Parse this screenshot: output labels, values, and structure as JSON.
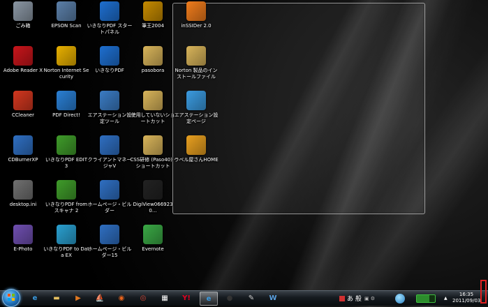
{
  "desktop_icons": [
    {
      "label": "ごみ箱",
      "icon": "recycle-bin-icon",
      "color": "#8a96a3"
    },
    {
      "label": "EPSON Scan",
      "icon": "scanner-icon",
      "color": "#5b7fa8"
    },
    {
      "label": "いきなりPDF スタートパネル",
      "icon": "pdf-start-panel-icon",
      "color": "#1e6fd0"
    },
    {
      "label": "筆王2004",
      "icon": "fudeou-icon",
      "color": "#c58a00"
    },
    {
      "label": "inSSIDer 2.0",
      "icon": "inssider-icon",
      "color": "#f07c1c"
    },
    {
      "label": "Adobe Reader X",
      "icon": "adobe-reader-icon",
      "color": "#c8151b"
    },
    {
      "label": "Norton Internet Security",
      "icon": "norton-icon",
      "color": "#e8b000"
    },
    {
      "label": "いきなりPDF",
      "icon": "ikinari-pdf-icon",
      "color": "#1e6fd0"
    },
    {
      "label": "pasobora",
      "icon": "folder-icon",
      "color": "#d8b45a"
    },
    {
      "label": "Norton 製品のインストールファイル",
      "icon": "folder-icon",
      "color": "#d8b45a"
    },
    {
      "label": "CCleaner",
      "icon": "ccleaner-icon",
      "color": "#d2371f"
    },
    {
      "label": "PDF Direct!",
      "icon": "pdf-direct-icon",
      "color": "#2a7fd4"
    },
    {
      "label": "エアステーション設定ツール",
      "icon": "airstation-tool-icon",
      "color": "#3b7cc4"
    },
    {
      "label": "使用していないショートカット",
      "icon": "folder-icon",
      "color": "#d8b45a"
    },
    {
      "label": "エアステーション設定ページ",
      "icon": "ie-page-icon",
      "color": "#3b9be0"
    },
    {
      "label": "CDBurnerXP",
      "icon": "cdburner-icon",
      "color": "#2f6fc2"
    },
    {
      "label": "いきなりPDF EDIT 3",
      "icon": "pdf-edit-icon",
      "color": "#3f9b2a"
    },
    {
      "label": "クライアントマネージャV",
      "icon": "client-manager-icon",
      "color": "#2f6fc2"
    },
    {
      "label": "CSS研修 (Paso40) - ショートカット",
      "icon": "shortcut-folder-icon",
      "color": "#d8b45a"
    },
    {
      "label": "ラベル屋さんHOME",
      "icon": "label-ya-icon",
      "color": "#e8a020"
    },
    {
      "label": "desktop.ini",
      "icon": "file-icon",
      "color": "#707070"
    },
    {
      "label": "いきなりPDF from スキャナ 2",
      "icon": "pdf-scanner-icon",
      "color": "#3f9b2a"
    },
    {
      "label": "ホームページ・ビルダー",
      "icon": "homepage-builder-icon",
      "color": "#2f6fc2"
    },
    {
      "label": "DigiView0669230...",
      "icon": "digiview-icon",
      "color": "#222222"
    },
    {
      "label": "E-Photo",
      "icon": "ephoto-icon",
      "color": "#6f4fb0"
    },
    {
      "label": "いきなりPDF to Data EX",
      "icon": "pdf-data-ex-icon",
      "color": "#2aa0d0"
    },
    {
      "label": "ホームページ・ビルダー15",
      "icon": "homepage-builder-icon",
      "color": "#2f6fc2"
    },
    {
      "label": "Evernote",
      "icon": "evernote-icon",
      "color": "#3aa845"
    }
  ],
  "taskbar": {
    "pinned": [
      {
        "name": "internet-explorer-icon",
        "glyph": "e",
        "color": "#3b9be0"
      },
      {
        "name": "explorer-folder-icon",
        "glyph": "▬",
        "color": "#e6c060"
      },
      {
        "name": "media-player-icon",
        "glyph": "▶",
        "color": "#e07820"
      },
      {
        "name": "ship-app-icon",
        "glyph": "⛵",
        "color": "#9aa"
      },
      {
        "name": "firefox-icon",
        "glyph": "◉",
        "color": "#e8641c"
      },
      {
        "name": "chrome-icon",
        "glyph": "◎",
        "color": "#dd4b39"
      },
      {
        "name": "app-grid-icon",
        "glyph": "▦",
        "color": "#ffffff"
      },
      {
        "name": "yahoo-icon",
        "glyph": "Y!",
        "color": "#e00020"
      },
      {
        "name": "ie-page-icon",
        "glyph": "e",
        "color": "#3b9be0"
      },
      {
        "name": "dark-disc-icon",
        "glyph": "●",
        "color": "#333333"
      },
      {
        "name": "paint-icon",
        "glyph": "✎",
        "color": "#ccc"
      },
      {
        "name": "homepage-builder-icon",
        "glyph": "W",
        "color": "#5aa0e0"
      }
    ],
    "ime": "あ 般",
    "battery_icon": "battery-icon",
    "tray_arrow": "▲",
    "time": "16:35",
    "date": "2011/09/03"
  }
}
